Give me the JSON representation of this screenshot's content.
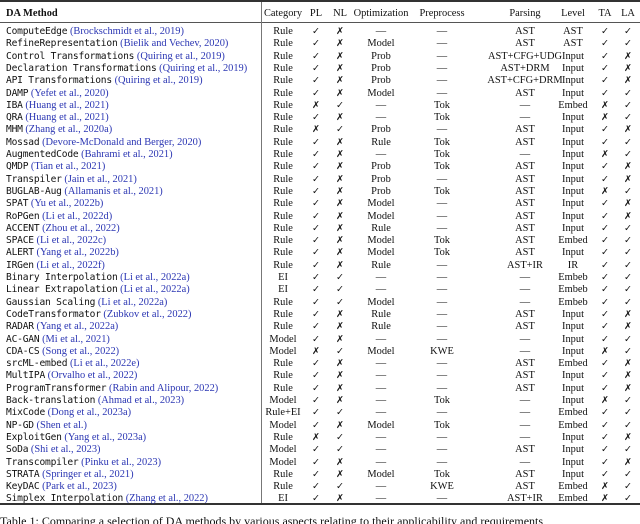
{
  "table": {
    "headers": [
      "DA Method",
      "Category",
      "PL",
      "NL",
      "Optimization",
      "Preprocess",
      "Parsing",
      "Level",
      "TA",
      "LA"
    ],
    "rows": [
      {
        "method": "ComputeEdge",
        "cite": "(Brockschmidt et al., 2019)",
        "cells": [
          "Rule",
          "✓",
          "✗",
          "—",
          "—",
          "AST",
          "AST",
          "✓",
          "✓"
        ]
      },
      {
        "method": "RefineRepresentation",
        "cite": "(Bielik and Vechev, 2020)",
        "cells": [
          "Rule",
          "✓",
          "✗",
          "Model",
          "—",
          "AST",
          "AST",
          "✓",
          "✓"
        ]
      },
      {
        "method": "Control Transformations",
        "cite": "(Quiring et al., 2019)",
        "cells": [
          "Rule",
          "✓",
          "✗",
          "Prob",
          "—",
          "AST+CFG+UDG",
          "Input",
          "✓",
          "✗"
        ]
      },
      {
        "method": "Declaration Transformations",
        "cite": "(Quiring et al., 2019)",
        "cells": [
          "Rule",
          "✓",
          "✗",
          "Prob",
          "—",
          "AST+DRM",
          "Input",
          "✓",
          "✗"
        ]
      },
      {
        "method": "API Transformations",
        "cite": "(Quiring et al., 2019)",
        "cells": [
          "Rule",
          "✓",
          "✗",
          "Prob",
          "—",
          "AST+CFG+DRM",
          "Input",
          "✓",
          "✗"
        ]
      },
      {
        "method": "DAMP",
        "cite": "(Yefet et al., 2020)",
        "cells": [
          "Rule",
          "✓",
          "✗",
          "Model",
          "—",
          "AST",
          "Input",
          "✓",
          "✓"
        ]
      },
      {
        "method": "IBA",
        "cite": "(Huang et al., 2021)",
        "cells": [
          "Rule",
          "✗",
          "✓",
          "—",
          "Tok",
          "—",
          "Embed",
          "✗",
          "✓"
        ]
      },
      {
        "method": "QRA",
        "cite": "(Huang et al., 2021)",
        "cells": [
          "Rule",
          "✓",
          "✗",
          "—",
          "Tok",
          "—",
          "Input",
          "✗",
          "✓"
        ]
      },
      {
        "method": "MHM",
        "cite": "(Zhang et al., 2020a)",
        "cells": [
          "Rule",
          "✗",
          "✓",
          "Prob",
          "—",
          "AST",
          "Input",
          "✓",
          "✗"
        ]
      },
      {
        "method": "Mossad",
        "cite": "(Devore-McDonald and Berger, 2020)",
        "cells": [
          "Rule",
          "✓",
          "✗",
          "Rule",
          "Tok",
          "AST",
          "Input",
          "✓",
          "✓"
        ]
      },
      {
        "method": "AugmentedCode",
        "cite": "(Bahrami et al., 2021)",
        "cells": [
          "Rule",
          "✓",
          "✗",
          "—",
          "Tok",
          "—",
          "Input",
          "✗",
          "✓"
        ]
      },
      {
        "method": "QMDP",
        "cite": "(Tian et al., 2021)",
        "cells": [
          "Rule",
          "✓",
          "✗",
          "Prob",
          "Tok",
          "AST",
          "Input",
          "✓",
          "✗"
        ]
      },
      {
        "method": "Transpiler",
        "cite": "(Jain et al., 2021)",
        "cells": [
          "Rule",
          "✓",
          "✗",
          "Prob",
          "—",
          "AST",
          "Input",
          "✓",
          "✗"
        ]
      },
      {
        "method": "BUGLAB-Aug",
        "cite": "(Allamanis et al., 2021)",
        "cells": [
          "Rule",
          "✓",
          "✗",
          "Prob",
          "Tok",
          "AST",
          "Input",
          "✗",
          "✓"
        ]
      },
      {
        "method": "SPAT",
        "cite": "(Yu et al., 2022b)",
        "cells": [
          "Rule",
          "✓",
          "✗",
          "Model",
          "—",
          "AST",
          "Input",
          "✓",
          "✗"
        ]
      },
      {
        "method": "RoPGen",
        "cite": "(Li et al., 2022d)",
        "cells": [
          "Rule",
          "✓",
          "✗",
          "Model",
          "—",
          "AST",
          "Input",
          "✓",
          "✗"
        ]
      },
      {
        "method": "ACCENT",
        "cite": "(Zhou et al., 2022)",
        "cells": [
          "Rule",
          "✓",
          "✗",
          "Rule",
          "—",
          "AST",
          "Input",
          "✓",
          "✓"
        ]
      },
      {
        "method": "SPACE",
        "cite": "(Li et al., 2022c)",
        "cells": [
          "Rule",
          "✓",
          "✗",
          "Model",
          "Tok",
          "AST",
          "Embed",
          "✓",
          "✓"
        ]
      },
      {
        "method": "ALERT",
        "cite": "(Yang et al., 2022b)",
        "cells": [
          "Rule",
          "✓",
          "✗",
          "Model",
          "Tok",
          "AST",
          "Input",
          "✓",
          "✓"
        ]
      },
      {
        "method": "IRGen",
        "cite": "(Li et al., 2022f)",
        "cells": [
          "Rule",
          "✓",
          "✗",
          "Rule",
          "—",
          "AST+IR",
          "IR",
          "✓",
          "✓"
        ]
      },
      {
        "method": "Binary Interpolation",
        "cite": "(Li et al., 2022a)",
        "cells": [
          "EI",
          "✓",
          "✓",
          "—",
          "—",
          "—",
          "Embeb",
          "✓",
          "✓"
        ]
      },
      {
        "method": "Linear Extrapolation",
        "cite": "(Li et al., 2022a)",
        "cells": [
          "EI",
          "✓",
          "✓",
          "—",
          "—",
          "—",
          "Embeb",
          "✓",
          "✓"
        ]
      },
      {
        "method": "Gaussian Scaling",
        "cite": "(Li et al., 2022a)",
        "cells": [
          "Rule",
          "✓",
          "✓",
          "Model",
          "—",
          "—",
          "Embeb",
          "✓",
          "✓"
        ]
      },
      {
        "method": "CodeTransformator",
        "cite": "(Zubkov et al., 2022)",
        "cells": [
          "Rule",
          "✓",
          "✗",
          "Rule",
          "—",
          "AST",
          "Input",
          "✓",
          "✗"
        ]
      },
      {
        "method": "RADAR",
        "cite": "(Yang et al., 2022a)",
        "cells": [
          "Rule",
          "✓",
          "✗",
          "Rule",
          "—",
          "AST",
          "Input",
          "✓",
          "✗"
        ]
      },
      {
        "method": "AC-GAN",
        "cite": "(Mi et al., 2021)",
        "cells": [
          "Model",
          "✓",
          "✗",
          "—",
          "—",
          "—",
          "Input",
          "✓",
          "✓"
        ]
      },
      {
        "method": "CDA-CS",
        "cite": "(Song et al., 2022)",
        "cells": [
          "Model",
          "✗",
          "✓",
          "Model",
          "KWE",
          "—",
          "Input",
          "✗",
          "✓"
        ]
      },
      {
        "method": "srcML-embed",
        "cite": "(Li et al., 2022e)",
        "cells": [
          "Rule",
          "✓",
          "✗",
          "—",
          "—",
          "AST",
          "Embed",
          "✓",
          "✗"
        ]
      },
      {
        "method": "MultIPA",
        "cite": "(Orvalho et al., 2022)",
        "cells": [
          "Rule",
          "✓",
          "✗",
          "—",
          "—",
          "AST",
          "Input",
          "✓",
          "✗"
        ]
      },
      {
        "method": "ProgramTransformer",
        "cite": "(Rabin and Alipour, 2022)",
        "cells": [
          "Rule",
          "✓",
          "✗",
          "—",
          "—",
          "AST",
          "Input",
          "✓",
          "✗"
        ]
      },
      {
        "method": "Back-translation",
        "cite": "(Ahmad et al., 2023)",
        "cells": [
          "Model",
          "✓",
          "✗",
          "—",
          "Tok",
          "—",
          "Input",
          "✗",
          "✓"
        ]
      },
      {
        "method": "MixCode",
        "cite": "(Dong et al., 2023a)",
        "cells": [
          "Rule+EI",
          "✓",
          "✓",
          "—",
          "—",
          "—",
          "Embed",
          "✓",
          "✓"
        ]
      },
      {
        "method": "NP-GD",
        "cite": "(Shen et al.)",
        "cells": [
          "Model",
          "✓",
          "✗",
          "Model",
          "Tok",
          "—",
          "Embed",
          "✓",
          "✓"
        ]
      },
      {
        "method": "ExploitGen",
        "cite": "(Yang et al., 2023a)",
        "cells": [
          "Rule",
          "✗",
          "✓",
          "—",
          "—",
          "—",
          "Input",
          "✓",
          "✗"
        ]
      },
      {
        "method": "SoDa",
        "cite": "(Shi et al., 2023)",
        "cells": [
          "Model",
          "✓",
          "✓",
          "—",
          "—",
          "AST",
          "Input",
          "✓",
          "✓"
        ]
      },
      {
        "method": "Transcompiler",
        "cite": "(Pinku et al., 2023)",
        "cells": [
          "Model",
          "✓",
          "✗",
          "—",
          "—",
          "—",
          "Input",
          "✓",
          "✗"
        ]
      },
      {
        "method": "STRATA",
        "cite": "(Springer et al., 2021)",
        "cells": [
          "Rule",
          "✓",
          "✗",
          "Model",
          "Tok",
          "AST",
          "Input",
          "✓",
          "✓"
        ]
      },
      {
        "method": "KeyDAC",
        "cite": "(Park et al., 2023)",
        "cells": [
          "Rule",
          "✓",
          "✓",
          "—",
          "KWE",
          "AST",
          "Embed",
          "✗",
          "✓"
        ]
      },
      {
        "method": "Simplex Interpolation",
        "cite": "(Zhang et al., 2022)",
        "cells": [
          "EI",
          "✓",
          "✗",
          "—",
          "—",
          "AST+IR",
          "Embed",
          "✗",
          "✓"
        ]
      }
    ]
  },
  "caption": "Table 1: Comparing a selection of DA methods by various aspects relating to their applicability and requirements",
  "colors": {
    "citation": "#2b36b3",
    "rules": "#333333"
  }
}
